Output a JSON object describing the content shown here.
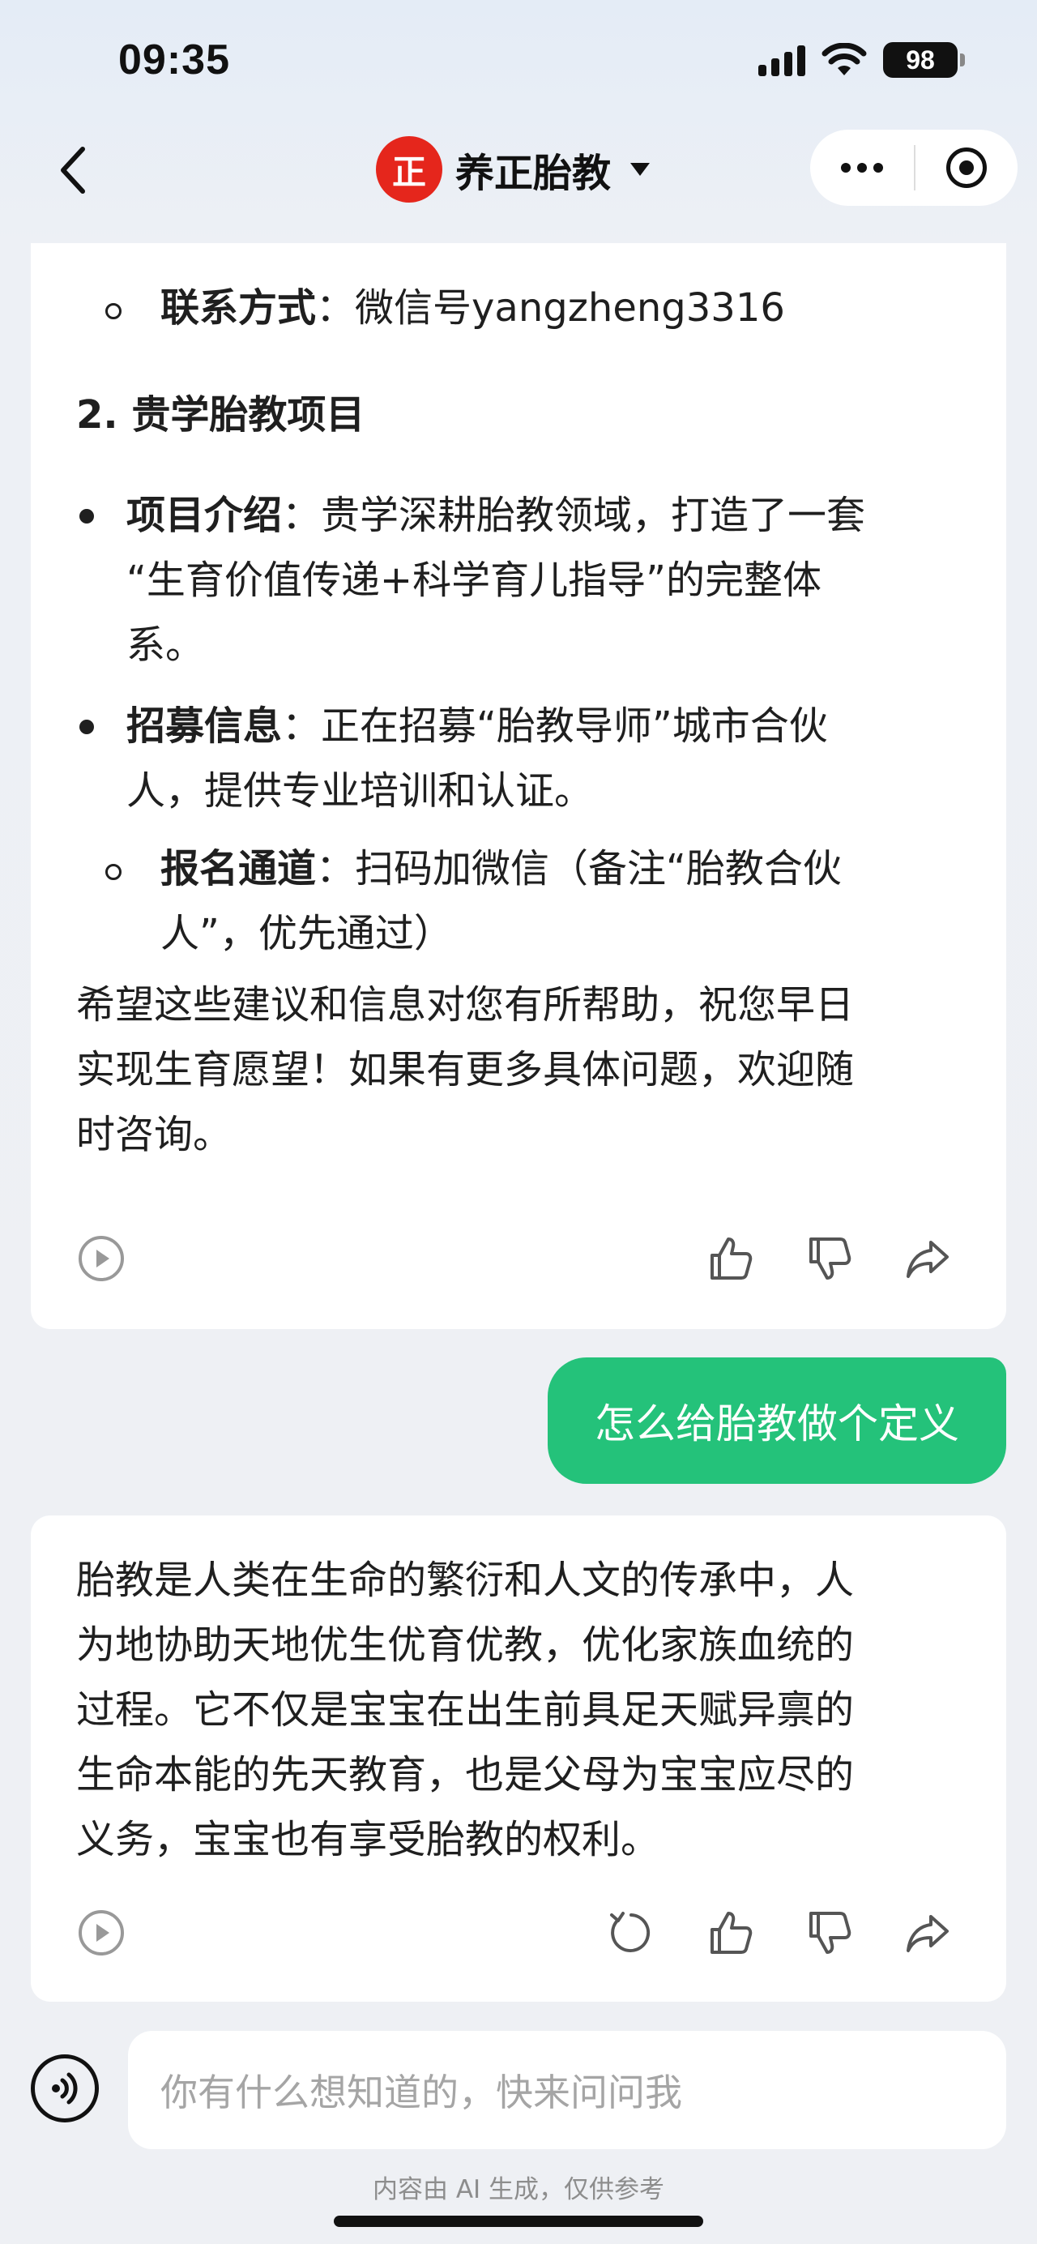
{
  "status_bar": {
    "time": "09:35",
    "battery": "98",
    "icons": [
      "signal-icon",
      "wifi-icon",
      "battery-icon"
    ]
  },
  "nav": {
    "back_icon": "chevron-left-icon",
    "logo_text": "正",
    "title": "养正胎教",
    "more_icon": "more-dots-icon",
    "close_icon": "target-close-icon"
  },
  "messages": {
    "bot1": {
      "contact_label": "联系方式",
      "contact_value": "：微信号yangzheng3316",
      "section_heading": "2. 贵学胎教项目",
      "intro_label": "项目介绍",
      "intro_line1": "：贵学深耕胎教领域，打造了一套",
      "intro_line2": "“生育价值传递+科学育儿指导”的完整体",
      "intro_line3": "系。",
      "recruit_label": "招募信息",
      "recruit_line1": "：正在招募“胎教导师”城市合伙",
      "recruit_line2": "人，提供专业培训和认证。",
      "signup_label": "报名通道",
      "signup_line1": "：扫码加微信（备注“胎教合伙",
      "signup_line2": "人”，优先通过）",
      "closing_line1": "希望这些建议和信息对您有所帮助，祝您早日",
      "closing_line2": "实现生育愿望！如果有更多具体问题，欢迎随",
      "closing_line3": "时咨询。"
    },
    "user": {
      "text": "怎么给胎教做个定义"
    },
    "bot2": {
      "line1": "胎教是人类在生命的繁衍和人文的传承中，人",
      "line2": "为地协助天地优生优育优教，优化家族血统的",
      "line3": "过程。它不仅是宝宝在出生前具足天赋异禀的",
      "line4": "生命本能的先天教育，也是父母为宝宝应尽的",
      "line5": "义务，宝宝也有享受胎教的权利。"
    }
  },
  "input": {
    "placeholder": "你有什么想知道的，快来问问我",
    "voice_icon": "voice-icon",
    "disclaimer": "内容由 AI 生成，仅供参考"
  }
}
